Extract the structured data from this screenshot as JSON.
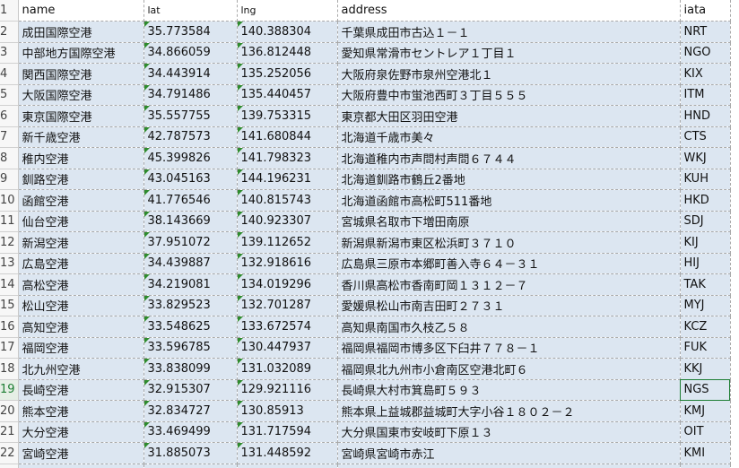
{
  "sheet": {
    "headers": [
      "name",
      "lat",
      "lng",
      "address",
      "iata"
    ],
    "header_row_number": "1",
    "rows": [
      {
        "n": "2",
        "name": "成田国際空港",
        "lat": "35.773584",
        "lng": "140.388304",
        "address": "千葉県成田市古込１－１",
        "iata": "NRT"
      },
      {
        "n": "3",
        "name": "中部地方国際空港",
        "lat": "34.866059",
        "lng": "136.812448",
        "address": "愛知県常滑市セントレア１丁目１",
        "iata": "NGO"
      },
      {
        "n": "4",
        "name": "関西国際空港",
        "lat": "34.443914",
        "lng": "135.252056",
        "address": "大阪府泉佐野市泉州空港北１",
        "iata": "KIX"
      },
      {
        "n": "5",
        "name": "大阪国際空港",
        "lat": "34.791486",
        "lng": "135.440457",
        "address": "大阪府豊中市蛍池西町３丁目５５５",
        "iata": "ITM"
      },
      {
        "n": "6",
        "name": "東京国際空港",
        "lat": "35.557755",
        "lng": "139.753315",
        "address": "東京都大田区羽田空港",
        "iata": "HND"
      },
      {
        "n": "7",
        "name": "新千歳空港",
        "lat": "42.787573",
        "lng": "141.680844",
        "address": "北海道千歳市美々",
        "iata": "CTS"
      },
      {
        "n": "8",
        "name": "稚内空港",
        "lat": "45.399826",
        "lng": "141.798323",
        "address": "北海道稚内市声問村声問６７４４",
        "iata": "WKJ"
      },
      {
        "n": "9",
        "name": "釧路空港",
        "lat": "43.045163",
        "lng": "144.196231",
        "address": "北海道釧路市鶴丘2番地",
        "iata": "KUH"
      },
      {
        "n": "10",
        "name": "函館空港",
        "lat": "41.776546",
        "lng": "140.815743",
        "address": "北海道函館市高松町511番地",
        "iata": "HKD"
      },
      {
        "n": "11",
        "name": "仙台空港",
        "lat": "38.143669",
        "lng": "140.923307",
        "address": "宮城県名取市下増田南原",
        "iata": "SDJ"
      },
      {
        "n": "12",
        "name": "新潟空港",
        "lat": "37.951072",
        "lng": "139.112652",
        "address": "新潟県新潟市東区松浜町３７１０",
        "iata": "KIJ"
      },
      {
        "n": "13",
        "name": "広島空港",
        "lat": "34.439887",
        "lng": "132.918616",
        "address": "広島県三原市本郷町善入寺６４－３１",
        "iata": "HIJ"
      },
      {
        "n": "14",
        "name": "高松空港",
        "lat": "34.219081",
        "lng": "134.019296",
        "address": "香川県高松市香南町岡１３１２－７",
        "iata": "TAK"
      },
      {
        "n": "15",
        "name": "松山空港",
        "lat": "33.829523",
        "lng": "132.701287",
        "address": "愛媛県松山市南吉田町２７３１",
        "iata": "MYJ"
      },
      {
        "n": "16",
        "name": "高知空港",
        "lat": "33.548625",
        "lng": "133.672574",
        "address": "高知県南国市久枝乙５８",
        "iata": "KCZ"
      },
      {
        "n": "17",
        "name": "福岡空港",
        "lat": "33.596785",
        "lng": "130.447937",
        "address": "福岡県福岡市博多区下臼井７７８－１",
        "iata": "FUK"
      },
      {
        "n": "18",
        "name": "北九州空港",
        "lat": "33.838099",
        "lng": "131.032089",
        "address": "福岡県北九州市小倉南区空港北町６",
        "iata": "KKJ"
      },
      {
        "n": "19",
        "name": "長崎空港",
        "lat": "32.915307",
        "lng": "129.921116",
        "address": "長崎県大村市箕島町５９３",
        "iata": "NGS"
      },
      {
        "n": "20",
        "name": "熊本空港",
        "lat": "32.834727",
        "lng": "130.85913",
        "address": "熊本県上益城郡益城町大字小谷１８０２－２",
        "iata": "KMJ"
      },
      {
        "n": "21",
        "name": "大分空港",
        "lat": "33.469499",
        "lng": "131.717594",
        "address": "大分県国東市安岐町下原１３",
        "iata": "OIT"
      },
      {
        "n": "22",
        "name": "宮崎空港",
        "lat": "31.885073",
        "lng": "131.448592",
        "address": "宮崎県宮崎市赤江",
        "iata": "KMI"
      }
    ],
    "active_row": "19",
    "selected_cell": "NGS"
  },
  "colors": {
    "cell_fill": "#dce6f1",
    "error_triangle": "#2e8b2e",
    "active_row_header": "#1e7e34"
  }
}
